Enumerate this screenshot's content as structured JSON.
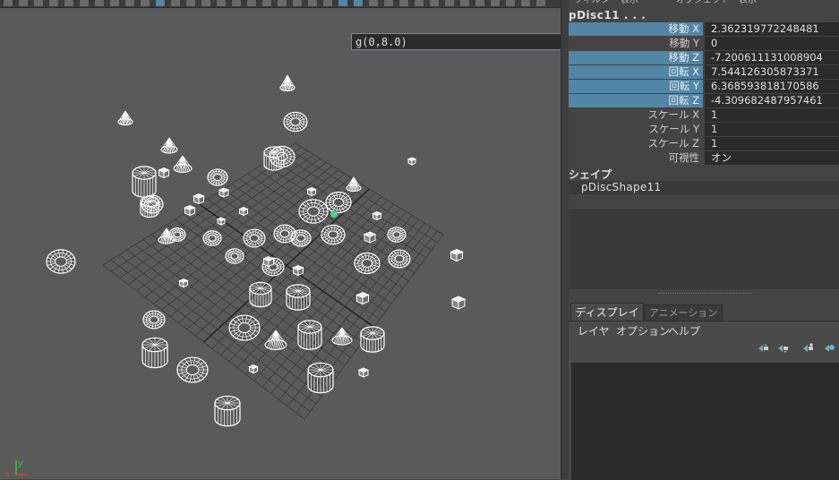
{
  "viewport": {
    "command_field": {
      "value": "g(0,8.0)"
    },
    "axis": {
      "x": "x",
      "y": "y"
    }
  },
  "panel": {
    "menu": [
      "フィルタ",
      "表示",
      "オブジェクト",
      "表示"
    ],
    "node_title": "pDisc11 . . .",
    "attributes": [
      {
        "label": "移動 X",
        "value": "2.362319772248481",
        "highlight": true
      },
      {
        "label": "移動 Y",
        "value": "0",
        "highlight": false
      },
      {
        "label": "移動 Z",
        "value": "-7.200611131008904",
        "highlight": true
      },
      {
        "label": "回転 X",
        "value": "7.544126305873371",
        "highlight": true
      },
      {
        "label": "回転 Y",
        "value": "6.368593818170586",
        "highlight": true
      },
      {
        "label": "回転 Z",
        "value": "-4.309682487957461",
        "highlight": true
      },
      {
        "label": "スケール X",
        "value": "1",
        "highlight": false
      },
      {
        "label": "スケール Y",
        "value": "1",
        "highlight": false
      },
      {
        "label": "スケール Z",
        "value": "1",
        "highlight": false
      },
      {
        "label": "可視性",
        "value": "オン",
        "highlight": false
      }
    ],
    "shape_header": "シェイプ",
    "shape_item": "pDiscShape11",
    "tabs": {
      "display": "ディスプレイ",
      "animation": "アニメーション"
    },
    "layer_menu": {
      "layers": "レイヤ",
      "options": "オプション",
      "help": "ヘルプ"
    },
    "icons": [
      "move-layer-up-icon",
      "move-layer-down-icon",
      "new-layer-icon",
      "new-layer-from-selected-icon"
    ]
  },
  "colors": {
    "accent": "#5285a6",
    "field_bg": "#2b2b2b",
    "viewport_bg": "#5a5a5a"
  }
}
